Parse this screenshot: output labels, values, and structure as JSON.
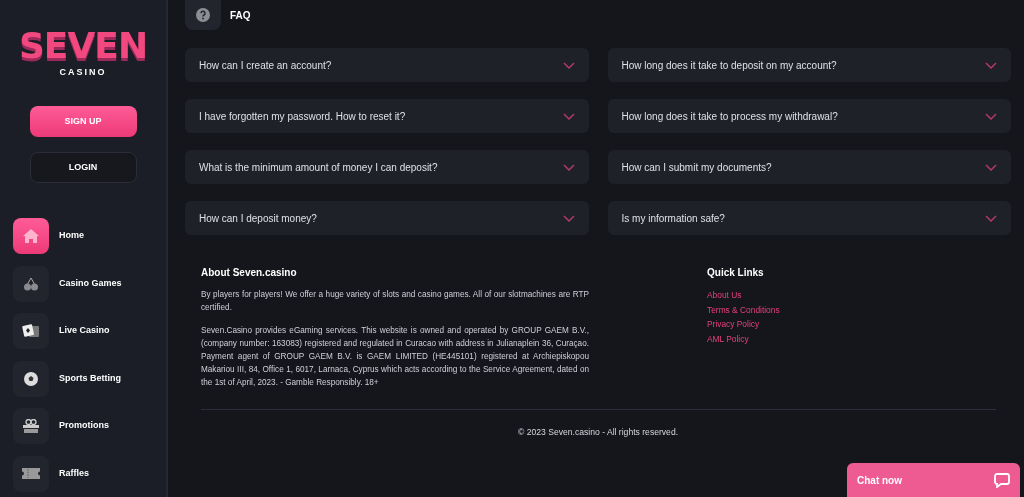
{
  "logo": {
    "title": "SEVEN",
    "subtitle": "CASINO"
  },
  "auth_buttons": [
    {
      "label": "SIGN UP",
      "kind": "primary"
    },
    {
      "label": "LOGIN",
      "kind": "outline"
    }
  ],
  "nav": [
    {
      "label": "Home",
      "selected": true
    },
    {
      "label": "Casino Games",
      "selected": false
    },
    {
      "label": "Live Casino",
      "selected": false
    },
    {
      "label": "Sports Betting",
      "selected": false
    },
    {
      "label": "Promotions",
      "selected": false
    },
    {
      "label": "Raffles",
      "selected": false
    }
  ],
  "faq": {
    "title": "FAQ",
    "questions": [
      "How can I create an account?",
      "I have forgotten my password. How to reset it?",
      "What is the minimum amount of money I can deposit?",
      "How can I deposit money?",
      "How long does it take to deposit on my account?",
      "How long does it take to process my withdrawal?",
      "How can I submit my documents?",
      "Is my information safe?"
    ]
  },
  "about": {
    "title": "About Seven.casino",
    "paragraphs": [
      "By players for players! We offer a huge variety of slots and casino games. All of our slotmachines are RTP certified.",
      "Seven.Casino provides eGaming services. This website is owned and operated by GROUP GAEM B.V., (company number: 163083) registered and regulated in Curacao with address in Julianaplein 36, Curaçao. Payment agent of GROUP GAEM B.V. is GAEM LIMITED (HE445101) registered at Archiepiskopou Makariou III, 84, Office 1, 6017, Larnaca, Cyprus which acts according to the Service Agreement, dated on the 1st of April, 2023. - Gamble Responsibly. 18+"
    ]
  },
  "quick_links": {
    "title": "Quick Links",
    "links": [
      "About Us",
      "Terms & Conditions",
      "Privacy Policy",
      "AML Policy"
    ]
  },
  "copyright": "© 2023 Seven.casino - All rights reserved.",
  "chat": {
    "label": "Chat now"
  }
}
